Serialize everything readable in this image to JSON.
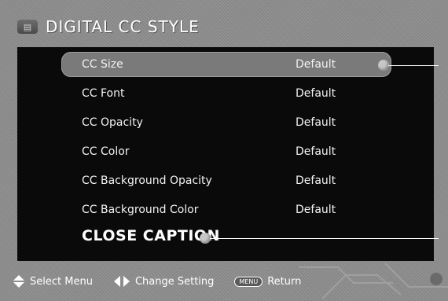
{
  "header": {
    "title": "DIGITAL CC STYLE"
  },
  "menu": {
    "items": [
      {
        "label": "CC Size",
        "value": "Default",
        "selected": true
      },
      {
        "label": "CC Font",
        "value": "Default"
      },
      {
        "label": "CC Opacity",
        "value": "Default"
      },
      {
        "label": "CC Color",
        "value": "Default"
      },
      {
        "label": "CC Background Opacity",
        "value": "Default"
      },
      {
        "label": "CC Background Color",
        "value": "Default"
      }
    ],
    "close_caption_label": "CLOSE CAPTION"
  },
  "footer": {
    "select_label": "Select Menu",
    "change_label": "Change Setting",
    "menu_key_label": "MENU",
    "return_label": "Return"
  },
  "colors": {
    "background": "#8c8c8c",
    "panel": "#0a0a0a",
    "selected_row": "#7a7a7a",
    "text": "#ffffff"
  }
}
